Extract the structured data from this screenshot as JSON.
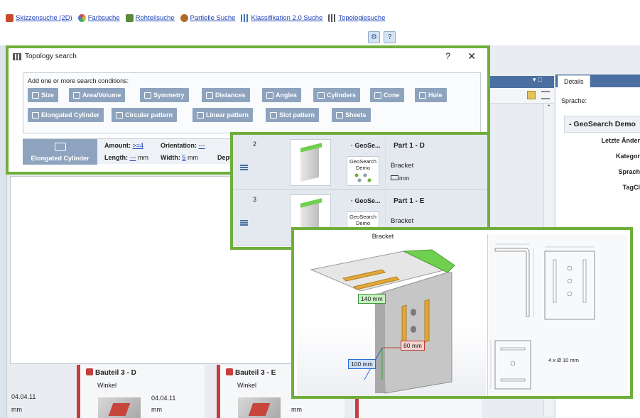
{
  "toolbar": {
    "links": [
      {
        "label": "Skizzensuche (2D)",
        "icon": "sketch-icon",
        "color": "#c84a2a"
      },
      {
        "label": "Farbsuche",
        "icon": "color-wheel-icon",
        "color": "#e09a1f"
      },
      {
        "label": "Rohteilsuche",
        "icon": "raw-part-icon",
        "color": "#5a8a3a"
      },
      {
        "label": "Partielle Suche",
        "icon": "partial-search-icon",
        "color": "#b06a2a"
      },
      {
        "label": "Klassifikation 2.0 Suche",
        "icon": "classification-icon",
        "color": "#3a7ab0"
      },
      {
        "label": "Topologiesuche",
        "icon": "topology-icon",
        "color": "#555555"
      }
    ]
  },
  "dialog": {
    "title": "Topology search",
    "help": "?",
    "close": "✕",
    "instructions": "Add one or more search conditions:",
    "chips_row1": [
      "Size",
      "Area/Volume",
      "Symmetry",
      "Distances",
      "Angles",
      "Cylinders",
      "Cone",
      "Hole"
    ],
    "chips_row2": [
      "Elongated Cylinder",
      "Circular pattern",
      "Linear pattern",
      "Slot pattern",
      "Sheets"
    ],
    "condition": {
      "name": "Elongated Cylinder",
      "amount_label": "Amount:",
      "amount_value": ">=4",
      "orientation_label": "Orientation:",
      "orientation_value": "---",
      "length_label": "Length:",
      "length_value": "---",
      "length_unit": "mm",
      "width_label": "Width:",
      "width_value": "5",
      "width_unit": "mm",
      "depth_label": "Depth:"
    }
  },
  "results": [
    {
      "num": "2",
      "geosearch": "· GeoSe...",
      "demo": "GeoSearch Demo",
      "part": "Part 1 - D",
      "desc": "Bracket",
      "unit": "mm"
    },
    {
      "num": "3",
      "geosearch": "· GeoSe...",
      "demo": "GeoSearch Demo",
      "part": "Part 1 - E",
      "desc": "Bracket",
      "unit": ""
    }
  ],
  "viewer": {
    "title": "Bracket",
    "dim1": "140 mm",
    "dim2": "80 mm",
    "dim3": "100 mm",
    "drawing_note": "4 x Ø 10 mm",
    "accent_green": "#6fcf4e",
    "slot_color": "#e0a83a"
  },
  "details": {
    "tab": "Details",
    "language_label": "Sprache:",
    "group": "- GeoSearch Demo",
    "props": [
      "Letzte Änder",
      "Kategor",
      "Sprach",
      "TagCl"
    ]
  },
  "cards": [
    {
      "title": "Bauteil 3 - D",
      "sub": "Winkel"
    },
    {
      "title": "Bauteil 3 - E",
      "sub": "Winkel"
    }
  ],
  "side_texts": {
    "date1": "04.04.11",
    "mm1": "mm",
    "date2": "04.04.11",
    "mm2": "mm",
    "mm3": "mm"
  },
  "colors": {
    "frame_green": "#6fae3c",
    "chip_blue": "#8ea3be",
    "header_blue": "#4a6fa0",
    "card_red": "#c63d3d"
  }
}
